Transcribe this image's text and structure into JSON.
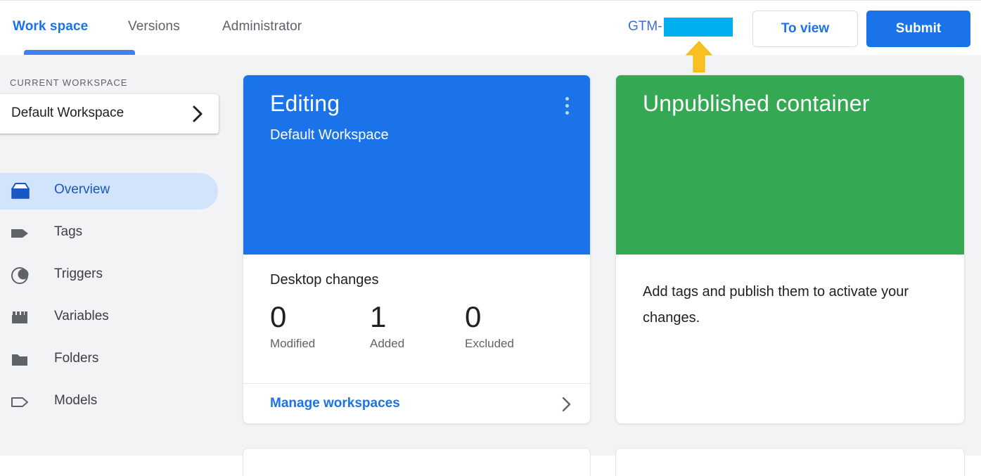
{
  "topbar": {
    "tabs": [
      {
        "label": "Work space",
        "active": true
      },
      {
        "label": "Versions",
        "active": false
      },
      {
        "label": "Administrator",
        "active": false
      }
    ],
    "container_id_prefix": "GTM-",
    "container_id_redacted": true,
    "redaction_color": "#00aff0",
    "to_view_label": "To view",
    "submit_label": "Submit",
    "submit_color": "#1a73e8"
  },
  "annotation": {
    "type": "up-arrow",
    "color": "#f9c01f"
  },
  "sidebar": {
    "heading": "CURRENT WORKSPACE",
    "workspace_selector": {
      "label": "Default Workspace",
      "chevron": "chevron-right-icon"
    },
    "items": [
      {
        "label": "Overview",
        "icon": "overview-box-icon",
        "active": true
      },
      {
        "label": "Tags",
        "icon": "tag-filled-icon",
        "active": false
      },
      {
        "label": "Triggers",
        "icon": "trigger-circle-icon",
        "active": false
      },
      {
        "label": "Variables",
        "icon": "variable-brick-icon",
        "active": false
      },
      {
        "label": "Folders",
        "icon": "folder-icon",
        "active": false
      },
      {
        "label": "Models",
        "icon": "tag-outline-icon",
        "active": false
      }
    ],
    "active_pill_color": "#d2e3fc"
  },
  "cards": {
    "editing": {
      "hero_color": "#1a73e8",
      "title": "Editing",
      "subtitle": "Default Workspace",
      "menu_icon": "more-vertical-icon",
      "changes_label": "Desktop changes",
      "stats": [
        {
          "value": "0",
          "label": "Modified"
        },
        {
          "value": "1",
          "label": "Added"
        },
        {
          "value": "0",
          "label": "Excluded"
        }
      ],
      "manage_link": "Manage workspaces",
      "manage_chevron": "chevron-right-icon"
    },
    "container": {
      "hero_color": "#35a853",
      "title": "Unpublished container",
      "body": "Add tags and publish them to activate your changes."
    }
  }
}
